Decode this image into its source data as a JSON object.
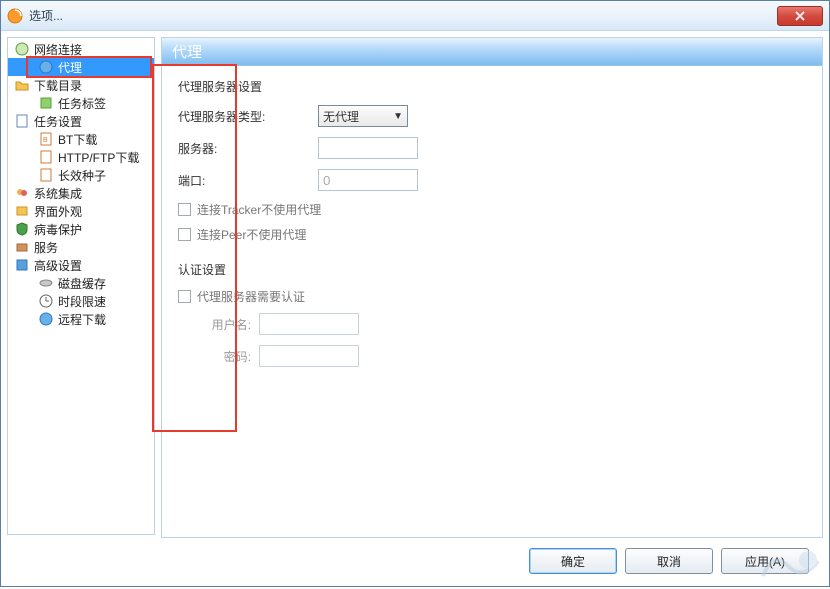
{
  "window": {
    "title": "选项..."
  },
  "sidebar": {
    "items": [
      {
        "label": "网络连接",
        "type": "top"
      },
      {
        "label": "代理",
        "type": "child",
        "selected": true
      },
      {
        "label": "下载目录",
        "type": "top"
      },
      {
        "label": "任务标签",
        "type": "child"
      },
      {
        "label": "任务设置",
        "type": "top"
      },
      {
        "label": "BT下载",
        "type": "child"
      },
      {
        "label": "HTTP/FTP下载",
        "type": "child"
      },
      {
        "label": "长效种子",
        "type": "child"
      },
      {
        "label": "系统集成",
        "type": "top"
      },
      {
        "label": "界面外观",
        "type": "top"
      },
      {
        "label": "病毒保护",
        "type": "top"
      },
      {
        "label": "服务",
        "type": "top"
      },
      {
        "label": "高级设置",
        "type": "top"
      },
      {
        "label": "磁盘缓存",
        "type": "child"
      },
      {
        "label": "时段限速",
        "type": "child"
      },
      {
        "label": "远程下载",
        "type": "child"
      }
    ]
  },
  "panel": {
    "header": "代理",
    "section1_title": "代理服务器设置",
    "type_label": "代理服务器类型:",
    "type_value": "无代理",
    "server_label": "服务器:",
    "server_value": "",
    "port_label": "端口:",
    "port_value": "0",
    "cb_tracker": "连接Tracker不使用代理",
    "cb_peer": "连接Peer不使用代理",
    "auth_title": "认证设置",
    "cb_auth": "代理服务器需要认证",
    "user_label": "用户名:",
    "user_value": "",
    "pass_label": "密码:",
    "pass_value": ""
  },
  "buttons": {
    "ok": "确定",
    "cancel": "取消",
    "apply": "应用(A)"
  }
}
